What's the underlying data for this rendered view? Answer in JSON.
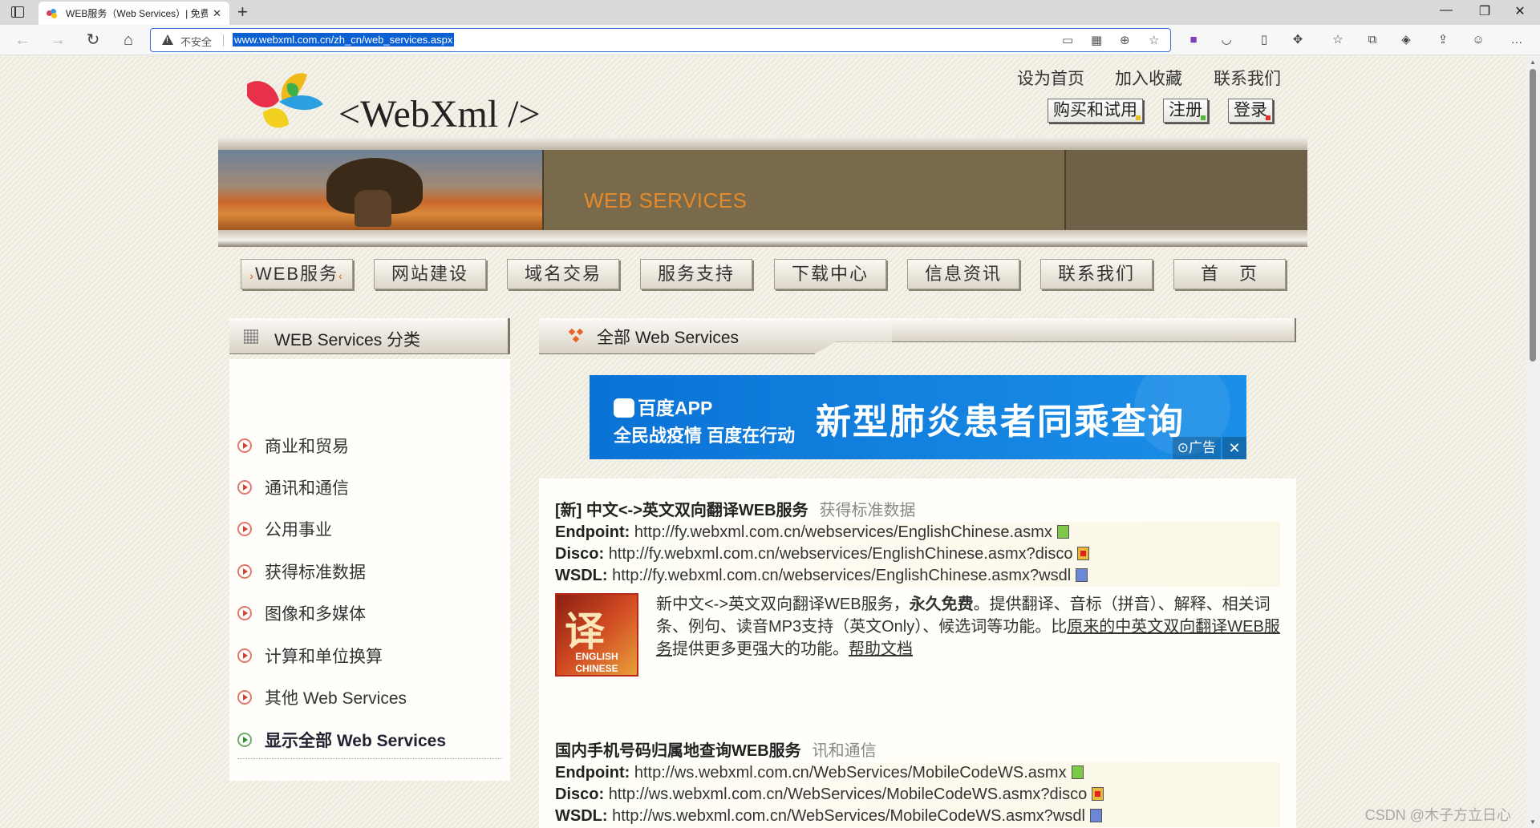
{
  "browser": {
    "tab_title": "WEB服务（Web Services）| 免费",
    "tab_close": "✕",
    "new_tab": "+",
    "not_secure_label": "不安全",
    "url": "www.webxml.com.cn/zh_cn/web_services.aspx",
    "window_controls": {
      "minimize": "—",
      "maximize": "❐",
      "close": "✕"
    },
    "nav": {
      "back": "←",
      "forward": "→",
      "refresh": "↻",
      "home": "⌂"
    }
  },
  "header": {
    "logo_text": "<WebXml />",
    "top_links": [
      "设为首页",
      "加入收藏",
      "联系我们"
    ],
    "top_buttons": [
      "购买和试用",
      "注册",
      "登录"
    ],
    "banner_title": "WEB SERVICES"
  },
  "nav_items": [
    {
      "label": "WEB服务",
      "active": true
    },
    {
      "label": "网站建设"
    },
    {
      "label": "域名交易"
    },
    {
      "label": "服务支持"
    },
    {
      "label": "下载中心"
    },
    {
      "label": "信息资讯"
    },
    {
      "label": "联系我们"
    },
    {
      "label": "首　页"
    }
  ],
  "sidebar": {
    "title": "WEB Services 分类",
    "categories": [
      "商业和贸易",
      "通讯和通信",
      "公用事业",
      "获得标准数据",
      "图像和多媒体",
      "计算和单位换算",
      "其他 Web Services",
      "显示全部 Web Services"
    ]
  },
  "main": {
    "title": "全部 Web Services",
    "ad": {
      "brand": "百度APP",
      "slogan": "全民战疫情 百度在行动",
      "headline": "新型肺炎患者同乘查询",
      "tag": "⊙广告",
      "close": "✕"
    },
    "services": [
      {
        "title": "[新] 中文<->英文双向翻译WEB服务",
        "category": "获得标准数据",
        "endpoint_label": "Endpoint:",
        "endpoint": "http://fy.webxml.com.cn/webservices/EnglishChinese.asmx",
        "disco_label": "Disco:",
        "disco": "http://fy.webxml.com.cn/webservices/EnglishChinese.asmx?disco",
        "wsdl_label": "WSDL:",
        "wsdl": "http://fy.webxml.com.cn/webservices/EnglishChinese.asmx?wsdl",
        "image_char": "译",
        "image_text_1": "ENGLISH",
        "image_text_2": "CHINESE",
        "desc_1": "新中文<->英文双向翻译WEB服务，",
        "desc_bold": "永久免费",
        "desc_2": "。提供翻译、音标（拼音）、解释、相关词条、例句、读音MP3支持（英文Only）、候选词等功能。比",
        "desc_link": "原来的中英文双向翻译WEB服务",
        "desc_3": "提供更多更强大的功能。",
        "help_link": "帮助文档"
      },
      {
        "title": "国内手机号码归属地查询WEB服务",
        "category": "讯和通信",
        "endpoint_label": "Endpoint:",
        "endpoint": "http://ws.webxml.com.cn/WebServices/MobileCodeWS.asmx",
        "disco_label": "Disco:",
        "disco": "http://ws.webxml.com.cn/WebServices/MobileCodeWS.asmx?disco",
        "wsdl_label": "WSDL:",
        "wsdl": "http://ws.webxml.com.cn/WebServices/MobileCodeWS.asmx?wsdl"
      }
    ]
  },
  "watermark": "CSDN @木子方立日心"
}
